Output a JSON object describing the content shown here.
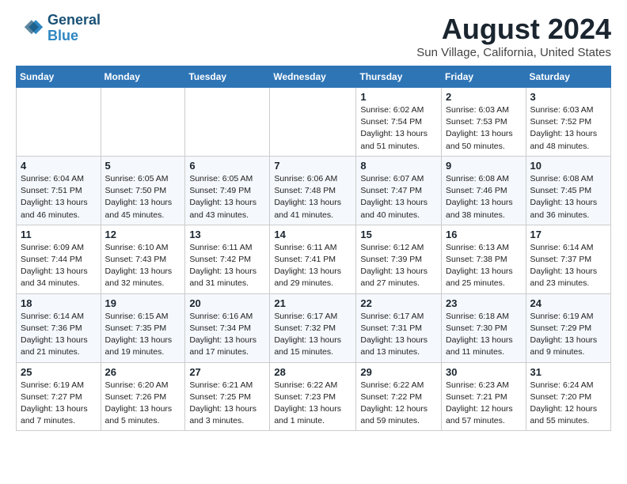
{
  "logo": {
    "line1": "General",
    "line2": "Blue"
  },
  "title": "August 2024",
  "subtitle": "Sun Village, California, United States",
  "header": {
    "accent_color": "#2e75b6"
  },
  "days_of_week": [
    "Sunday",
    "Monday",
    "Tuesday",
    "Wednesday",
    "Thursday",
    "Friday",
    "Saturday"
  ],
  "weeks": [
    [
      {
        "day": "",
        "info": ""
      },
      {
        "day": "",
        "info": ""
      },
      {
        "day": "",
        "info": ""
      },
      {
        "day": "",
        "info": ""
      },
      {
        "day": "1",
        "info": "Sunrise: 6:02 AM\nSunset: 7:54 PM\nDaylight: 13 hours\nand 51 minutes."
      },
      {
        "day": "2",
        "info": "Sunrise: 6:03 AM\nSunset: 7:53 PM\nDaylight: 13 hours\nand 50 minutes."
      },
      {
        "day": "3",
        "info": "Sunrise: 6:03 AM\nSunset: 7:52 PM\nDaylight: 13 hours\nand 48 minutes."
      }
    ],
    [
      {
        "day": "4",
        "info": "Sunrise: 6:04 AM\nSunset: 7:51 PM\nDaylight: 13 hours\nand 46 minutes."
      },
      {
        "day": "5",
        "info": "Sunrise: 6:05 AM\nSunset: 7:50 PM\nDaylight: 13 hours\nand 45 minutes."
      },
      {
        "day": "6",
        "info": "Sunrise: 6:05 AM\nSunset: 7:49 PM\nDaylight: 13 hours\nand 43 minutes."
      },
      {
        "day": "7",
        "info": "Sunrise: 6:06 AM\nSunset: 7:48 PM\nDaylight: 13 hours\nand 41 minutes."
      },
      {
        "day": "8",
        "info": "Sunrise: 6:07 AM\nSunset: 7:47 PM\nDaylight: 13 hours\nand 40 minutes."
      },
      {
        "day": "9",
        "info": "Sunrise: 6:08 AM\nSunset: 7:46 PM\nDaylight: 13 hours\nand 38 minutes."
      },
      {
        "day": "10",
        "info": "Sunrise: 6:08 AM\nSunset: 7:45 PM\nDaylight: 13 hours\nand 36 minutes."
      }
    ],
    [
      {
        "day": "11",
        "info": "Sunrise: 6:09 AM\nSunset: 7:44 PM\nDaylight: 13 hours\nand 34 minutes."
      },
      {
        "day": "12",
        "info": "Sunrise: 6:10 AM\nSunset: 7:43 PM\nDaylight: 13 hours\nand 32 minutes."
      },
      {
        "day": "13",
        "info": "Sunrise: 6:11 AM\nSunset: 7:42 PM\nDaylight: 13 hours\nand 31 minutes."
      },
      {
        "day": "14",
        "info": "Sunrise: 6:11 AM\nSunset: 7:41 PM\nDaylight: 13 hours\nand 29 minutes."
      },
      {
        "day": "15",
        "info": "Sunrise: 6:12 AM\nSunset: 7:39 PM\nDaylight: 13 hours\nand 27 minutes."
      },
      {
        "day": "16",
        "info": "Sunrise: 6:13 AM\nSunset: 7:38 PM\nDaylight: 13 hours\nand 25 minutes."
      },
      {
        "day": "17",
        "info": "Sunrise: 6:14 AM\nSunset: 7:37 PM\nDaylight: 13 hours\nand 23 minutes."
      }
    ],
    [
      {
        "day": "18",
        "info": "Sunrise: 6:14 AM\nSunset: 7:36 PM\nDaylight: 13 hours\nand 21 minutes."
      },
      {
        "day": "19",
        "info": "Sunrise: 6:15 AM\nSunset: 7:35 PM\nDaylight: 13 hours\nand 19 minutes."
      },
      {
        "day": "20",
        "info": "Sunrise: 6:16 AM\nSunset: 7:34 PM\nDaylight: 13 hours\nand 17 minutes."
      },
      {
        "day": "21",
        "info": "Sunrise: 6:17 AM\nSunset: 7:32 PM\nDaylight: 13 hours\nand 15 minutes."
      },
      {
        "day": "22",
        "info": "Sunrise: 6:17 AM\nSunset: 7:31 PM\nDaylight: 13 hours\nand 13 minutes."
      },
      {
        "day": "23",
        "info": "Sunrise: 6:18 AM\nSunset: 7:30 PM\nDaylight: 13 hours\nand 11 minutes."
      },
      {
        "day": "24",
        "info": "Sunrise: 6:19 AM\nSunset: 7:29 PM\nDaylight: 13 hours\nand 9 minutes."
      }
    ],
    [
      {
        "day": "25",
        "info": "Sunrise: 6:19 AM\nSunset: 7:27 PM\nDaylight: 13 hours\nand 7 minutes."
      },
      {
        "day": "26",
        "info": "Sunrise: 6:20 AM\nSunset: 7:26 PM\nDaylight: 13 hours\nand 5 minutes."
      },
      {
        "day": "27",
        "info": "Sunrise: 6:21 AM\nSunset: 7:25 PM\nDaylight: 13 hours\nand 3 minutes."
      },
      {
        "day": "28",
        "info": "Sunrise: 6:22 AM\nSunset: 7:23 PM\nDaylight: 13 hours\nand 1 minute."
      },
      {
        "day": "29",
        "info": "Sunrise: 6:22 AM\nSunset: 7:22 PM\nDaylight: 12 hours\nand 59 minutes."
      },
      {
        "day": "30",
        "info": "Sunrise: 6:23 AM\nSunset: 7:21 PM\nDaylight: 12 hours\nand 57 minutes."
      },
      {
        "day": "31",
        "info": "Sunrise: 6:24 AM\nSunset: 7:20 PM\nDaylight: 12 hours\nand 55 minutes."
      }
    ]
  ]
}
